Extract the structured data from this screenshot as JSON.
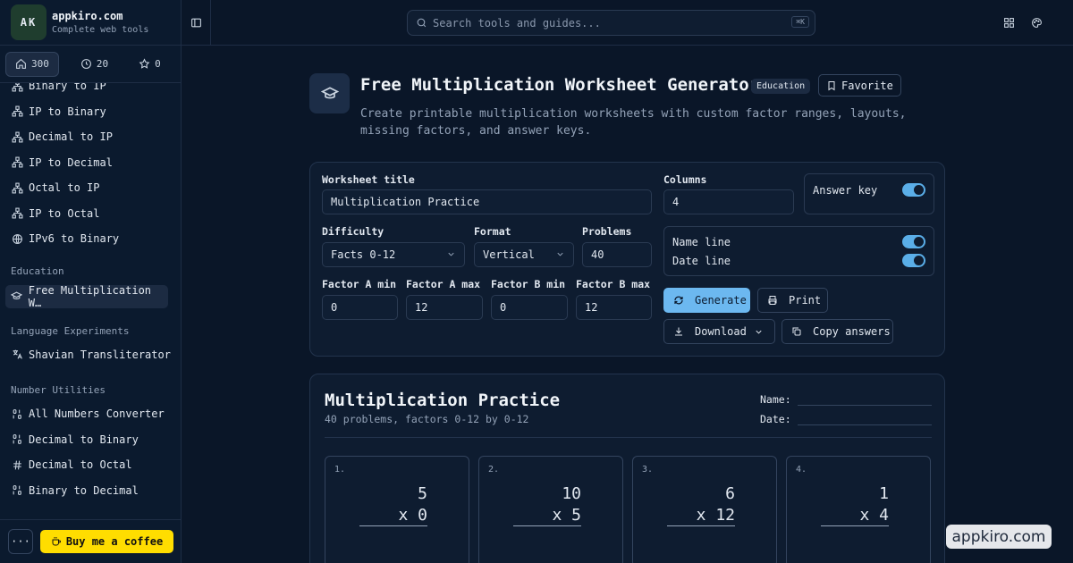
{
  "brand": {
    "initials": "AK",
    "name": "appkiro.com",
    "tagline": "Complete web tools"
  },
  "sidebar_tabs": [
    {
      "label": "300",
      "icon": "home-icon"
    },
    {
      "label": "20",
      "icon": "clock-icon"
    },
    {
      "label": "0",
      "icon": "star-icon"
    }
  ],
  "nav": {
    "network_items": [
      "Binary to IP",
      "IP to Binary",
      "Decimal to IP",
      "IP to Decimal",
      "Octal to IP",
      "IP to Octal"
    ],
    "ipv6_item": "IPv6 to Binary",
    "education_heading": "Education",
    "education_item": "Free Multiplication W…",
    "language_heading": "Language Experiments",
    "language_item": "Shavian Transliterator",
    "number_heading": "Number Utilities",
    "number_items": [
      "All Numbers Converter",
      "Decimal to Binary",
      "Decimal to Octal",
      "Binary to Decimal"
    ]
  },
  "footer": {
    "more": "···",
    "coffee": "Buy me a coffee"
  },
  "search": {
    "placeholder": "Search tools and guides...",
    "shortcut": "⌘K"
  },
  "header": {
    "title": "Free Multiplication Worksheet Generator",
    "badge": "Education",
    "favorite": "Favorite",
    "description": "Create printable multiplication worksheets with custom factor ranges, layouts, missing factors, and answer keys."
  },
  "form": {
    "worksheet_title_label": "Worksheet title",
    "worksheet_title_value": "Multiplication Practice",
    "columns_label": "Columns",
    "columns_value": "4",
    "answer_key_label": "Answer key",
    "answer_key_on": true,
    "difficulty_label": "Difficulty",
    "difficulty_value": "Facts 0-12",
    "format_label": "Format",
    "format_value": "Vertical",
    "problems_label": "Problems",
    "problems_value": "40",
    "name_line_label": "Name line",
    "name_line_on": true,
    "date_line_label": "Date line",
    "date_line_on": true,
    "factor_a_min_label": "Factor A min",
    "factor_a_min_value": "0",
    "factor_a_max_label": "Factor A max",
    "factor_a_max_value": "12",
    "factor_b_min_label": "Factor B min",
    "factor_b_min_value": "0",
    "factor_b_max_label": "Factor B max",
    "factor_b_max_value": "12",
    "generate": "Generate",
    "print": "Print",
    "download": "Download",
    "copy_answers": "Copy answers"
  },
  "worksheet": {
    "title": "Multiplication Practice",
    "subtitle": "40 problems, factors 0-12 by 0-12",
    "name_label": "Name:",
    "date_label": "Date:",
    "problems": [
      {
        "num": "1.",
        "a": "5",
        "b": "x 0"
      },
      {
        "num": "2.",
        "a": "10",
        "b": "x 5"
      },
      {
        "num": "3.",
        "a": "6",
        "b": "x 12"
      },
      {
        "num": "4.",
        "a": "1",
        "b": "x 4"
      }
    ]
  },
  "watermark": "appkiro.com",
  "colors": {
    "background": "#0a1628",
    "accent": "#6cb8f0",
    "coffee": "#ffdd00"
  }
}
